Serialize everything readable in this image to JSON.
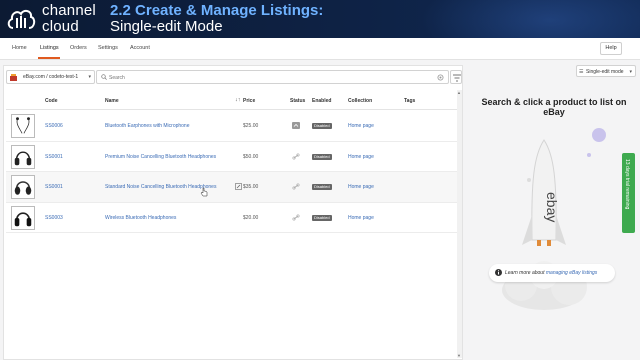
{
  "banner": {
    "logo_line1": "channel",
    "logo_line2": "cloud",
    "course_title": "2.2 Create & Manage Listings:",
    "course_subtitle": "Single-edit Mode"
  },
  "nav": {
    "items": [
      "Home",
      "Listings",
      "Orders",
      "Settings",
      "Account"
    ],
    "active": "Listings",
    "help_label": "Help"
  },
  "toolbar": {
    "store_label": "eBay.com / codeto-test-1",
    "search_placeholder": "Search"
  },
  "table": {
    "headers": {
      "code": "Code",
      "name": "Name",
      "price": "Price",
      "status": "Status",
      "enabled": "Enabled",
      "collection": "Collection",
      "tags": "Tags"
    },
    "rows": [
      {
        "code": "SS0006",
        "name": "Bluetooth Earphones with Microphone",
        "price": "$25.00",
        "enabled": "Disabled",
        "collection": "Home page"
      },
      {
        "code": "SS0001",
        "name": "Premium Noise Cancelling Bluetooth Headphones",
        "price": "$50.00",
        "enabled": "Disabled",
        "collection": "Home page"
      },
      {
        "code": "SS0001",
        "name": "Standard Noise Cancelling Bluetooth Headphones",
        "price": "$35.00",
        "enabled": "Disabled",
        "collection": "Home page"
      },
      {
        "code": "SS0003",
        "name": "Wireless Bluetooth Headphones",
        "price": "$20.00",
        "enabled": "Disabled",
        "collection": "Home page"
      }
    ]
  },
  "right_panel": {
    "mode_label": "Single-edit mode",
    "heading": "Search & click a product to list on eBay",
    "rocket_label": "ebay",
    "learn_prefix": "Learn more about",
    "learn_link": "managing eBay listings"
  },
  "trial_tab": {
    "label": "13 days trial remaining"
  },
  "colors": {
    "accent": "#e05a1f",
    "link": "#3a6bb5",
    "trial": "#3eaa4f",
    "banner": "#0e2245"
  }
}
